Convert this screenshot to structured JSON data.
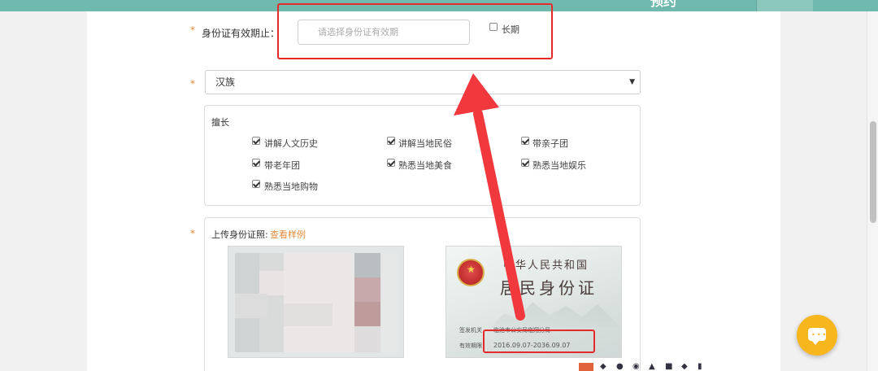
{
  "header": {
    "partial_text": "预约"
  },
  "id_validity": {
    "label": "身份证有效期止：",
    "placeholder": "请选择身份证有效期",
    "long_term_label": "长期",
    "long_term_checked": false
  },
  "ethnicity": {
    "selected": "汉族"
  },
  "skills": {
    "title": "擅长",
    "items": [
      {
        "label": "讲解人文历史",
        "checked": true
      },
      {
        "label": "讲解当地民俗",
        "checked": true
      },
      {
        "label": "带亲子团",
        "checked": true
      },
      {
        "label": "带老年团",
        "checked": true
      },
      {
        "label": "熟悉当地美食",
        "checked": true
      },
      {
        "label": "熟悉当地娱乐",
        "checked": true
      },
      {
        "label": "熟悉当地购物",
        "checked": true
      }
    ]
  },
  "upload": {
    "label": "上传身份证照:",
    "sample_link": "查看样例"
  },
  "id_card_back": {
    "title_line1": "中华人民共和国",
    "title_line2": "居民身份证",
    "authority_label": "签发机关",
    "authority_value": "临沧市公安局临翔分局",
    "validity_label": "有效期限",
    "validity_value": "2016.09.07-2036.09.07"
  },
  "colors": {
    "accent": "#e08a3c",
    "annotation_red": "#e52a2a",
    "header_teal": "#6fb9ae",
    "chat_yellow": "#f7b61b"
  },
  "icons": [
    "chat-icon",
    "chevron-down-icon",
    "checkbox-icon",
    "national-emblem-icon",
    "arrow-annotation"
  ]
}
